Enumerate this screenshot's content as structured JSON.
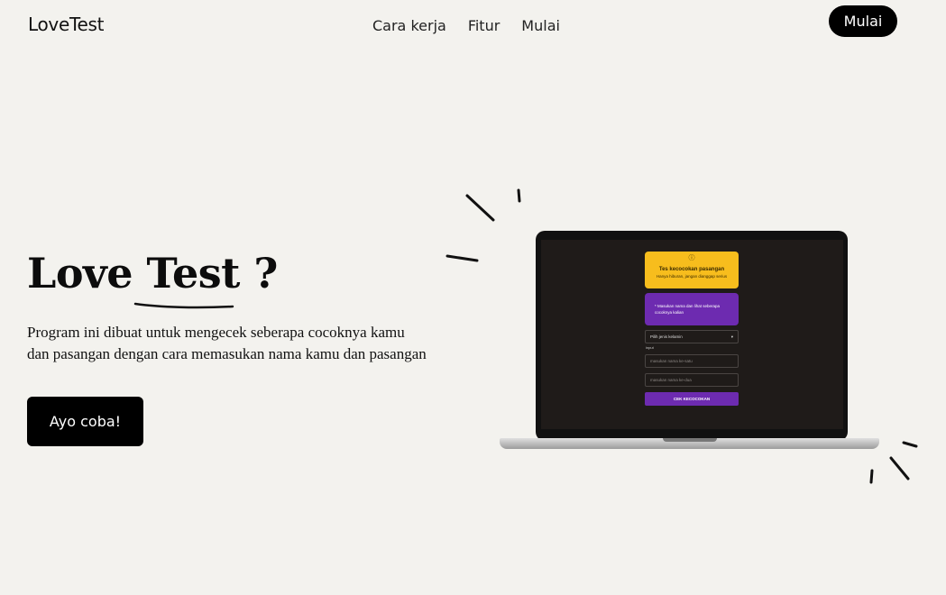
{
  "header": {
    "logo": "LoveTest",
    "nav": [
      "Cara kerja",
      "Fitur",
      "Mulai"
    ],
    "cta_label": "Mulai"
  },
  "hero": {
    "title_part1": "Love ",
    "title_part2": "Test",
    "title_part3": " ?",
    "description": "Program ini dibuat untuk mengecek seberapa cocoknya kamu dan pasangan dengan cara memasukan nama kamu dan pasangan",
    "button_label": "Ayo coba!"
  },
  "laptop_screen": {
    "info_icon": "info-icon",
    "card_title": "Tes kecocokan pasangan",
    "card_subtitle": "Hanya hiburan, jangan dianggap serius",
    "purple_text": "* Masukan nama dan lihat seberapa cocoknya kalian",
    "select_value": "Pilih jenis kelamin",
    "small_label": "input",
    "input1_placeholder": "masukan nama ke-satu",
    "input2_placeholder": "masukan nama ke-dua",
    "button_label": "CEK KECOCOKAN"
  },
  "colors": {
    "background": "#f3f2ee",
    "yellow": "#f7bd1d",
    "purple": "#6d2bb0",
    "black": "#000000"
  }
}
